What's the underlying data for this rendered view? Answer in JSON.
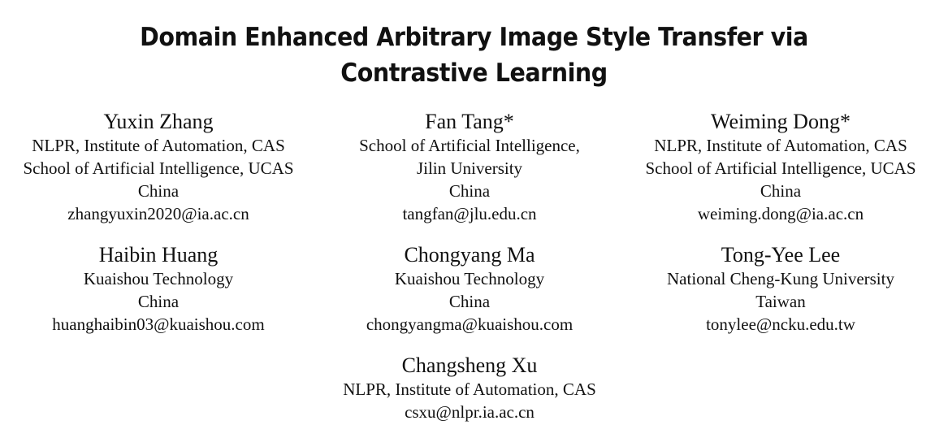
{
  "paper": {
    "title_line1": "Domain Enhanced Arbitrary Image Style Transfer via",
    "title_line2": "Contrastive Learning"
  },
  "authors": [
    {
      "name": "Yuxin Zhang",
      "affiliations": [
        "NLPR, Institute of Automation, CAS",
        "School of Artificial Intelligence, UCAS"
      ],
      "country": "China",
      "email": "zhangyuxin2020@ia.ac.cn"
    },
    {
      "name": "Fan Tang*",
      "affiliations": [
        "School of Artificial Intelligence,",
        "Jilin University"
      ],
      "country": "China",
      "email": "tangfan@jlu.edu.cn"
    },
    {
      "name": "Weiming Dong*",
      "affiliations": [
        "NLPR, Institute of Automation, CAS",
        "School of Artificial Intelligence, UCAS"
      ],
      "country": "China",
      "email": "weiming.dong@ia.ac.cn"
    },
    {
      "name": "Haibin Huang",
      "affiliations": [
        "Kuaishou Technology"
      ],
      "country": "China",
      "email": "huanghaibin03@kuaishou.com"
    },
    {
      "name": "Chongyang Ma",
      "affiliations": [
        "Kuaishou Technology"
      ],
      "country": "China",
      "email": "chongyangma@kuaishou.com"
    },
    {
      "name": "Tong-Yee Lee",
      "affiliations": [
        "National Cheng-Kung University"
      ],
      "country": "Taiwan",
      "email": "tonylee@ncku.edu.tw"
    },
    {
      "name": "Changsheng Xu",
      "affiliations": [
        "NLPR, Institute of Automation, CAS"
      ],
      "email": "csxu@nlpr.ia.ac.cn"
    }
  ]
}
